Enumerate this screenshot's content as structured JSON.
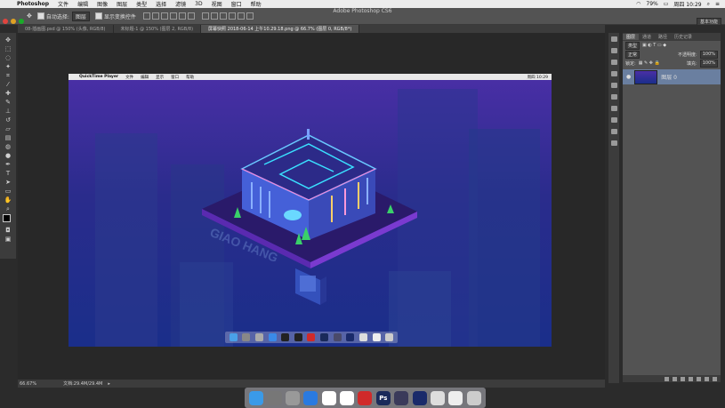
{
  "menubar": {
    "app": "Photoshop",
    "items": [
      "文件",
      "编辑",
      "图像",
      "图层",
      "类型",
      "选择",
      "滤镜",
      "3D",
      "视图",
      "窗口",
      "帮助"
    ],
    "battery": "79%",
    "clock": "周四 10:29"
  },
  "window": {
    "title": "Adobe Photoshop CS6"
  },
  "options": {
    "auto_select_label": "自动选择:",
    "auto_select_value": "图层",
    "show_transform_label": "显示变换控件",
    "workspace": "基本功能"
  },
  "tabs": [
    "08-插画图.psd @ 150% (头像, RGB/8)",
    "未标题-1 @ 150% (图层 2, RGB/8)",
    "屏幕快照 2018-06-14 上午10.29.18.png @ 66.7% (图层 0, RGB/8*)"
  ],
  "inner_app": {
    "menu": [
      "QuickTime Player",
      "文件",
      "编辑",
      "显示",
      "窗口",
      "帮助"
    ],
    "clock": "周四 10:29"
  },
  "artwork": {
    "sign_letters": "GIAO HANG"
  },
  "statusbar": {
    "zoom": "66.67%",
    "doc": "文档:29.4M/29.4M"
  },
  "layers_panel": {
    "tabs": [
      "图层",
      "通道",
      "路径",
      "历史记录"
    ],
    "kind": "类型",
    "blend": "正常",
    "opacity_label": "不透明度:",
    "opacity": "100%",
    "lock_label": "锁定:",
    "fill_label": "填充:",
    "fill": "100%",
    "layer_name": "图层 0"
  },
  "dock_icons": [
    "finder-icon",
    "launchpad-icon",
    "rocket-icon",
    "safari-icon",
    "qq-icon",
    "qq-icon-2",
    "netease-music-icon",
    "photoshop-icon",
    "quicktime-icon",
    "screen-icon",
    "preview-icon",
    "file-icon",
    "trash-icon"
  ]
}
